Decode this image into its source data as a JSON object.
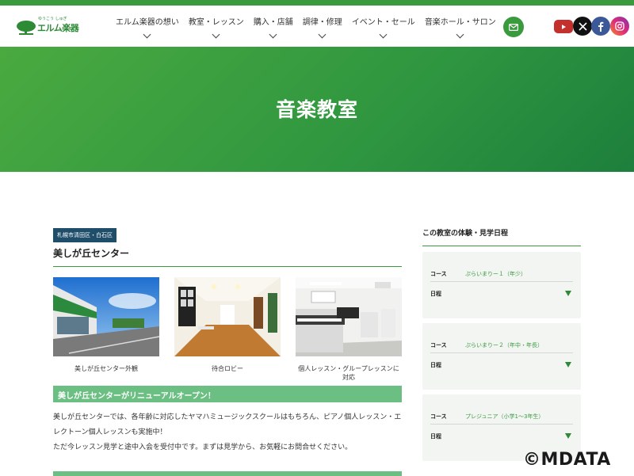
{
  "brand": {
    "logo_text": "エルム楽器",
    "logo_sub": "ゆうこう しゅぎ",
    "accent": "#3a9a3e",
    "dark_badge": "#1f4e6b",
    "section_green": "#6bbf82"
  },
  "nav": [
    {
      "label": "エルム楽器の想い"
    },
    {
      "label": "教室・レッスン"
    },
    {
      "label": "購入・店舗"
    },
    {
      "label": "調律・修理"
    },
    {
      "label": "イベント・セール"
    },
    {
      "label": "音楽ホール・サロン"
    }
  ],
  "icons": {
    "mail": "mail-icon",
    "youtube": "youtube-icon",
    "x": "x-icon",
    "facebook": "facebook-icon",
    "instagram": "instagram-icon"
  },
  "hero": {
    "title": "音楽教室"
  },
  "main": {
    "area_badge": "札幌市清田区・白石区",
    "center_title": "美しが丘センター",
    "photos": [
      {
        "caption": "美しが丘センター外観"
      },
      {
        "caption": "待合ロビー"
      },
      {
        "caption": "個人レッスン・グループレッスンに対応"
      }
    ],
    "section_title": "美しが丘センターがリニューアルオープン！",
    "paragraph1": "美しが丘センターでは、各年齢に対応したヤマハミュージックスクールはもちろん、ピアノ個人レッスン・エレクトーン個人レッスンも実施中！",
    "paragraph2": "ただ今レッスン見学と途中入会を受付中です。まずは見学から、お気軽にお問合せください。"
  },
  "sidebar": {
    "title": "この教室の体験・見学日程",
    "course_label": "コース",
    "schedule_label": "日程",
    "cards": [
      {
        "course": "ぷらいまりー１（年少）"
      },
      {
        "course": "ぷらいまりー２（年中・年長）"
      },
      {
        "course": "プレジュニア（小学1〜3年生）"
      }
    ]
  },
  "watermark": "©MDATA"
}
